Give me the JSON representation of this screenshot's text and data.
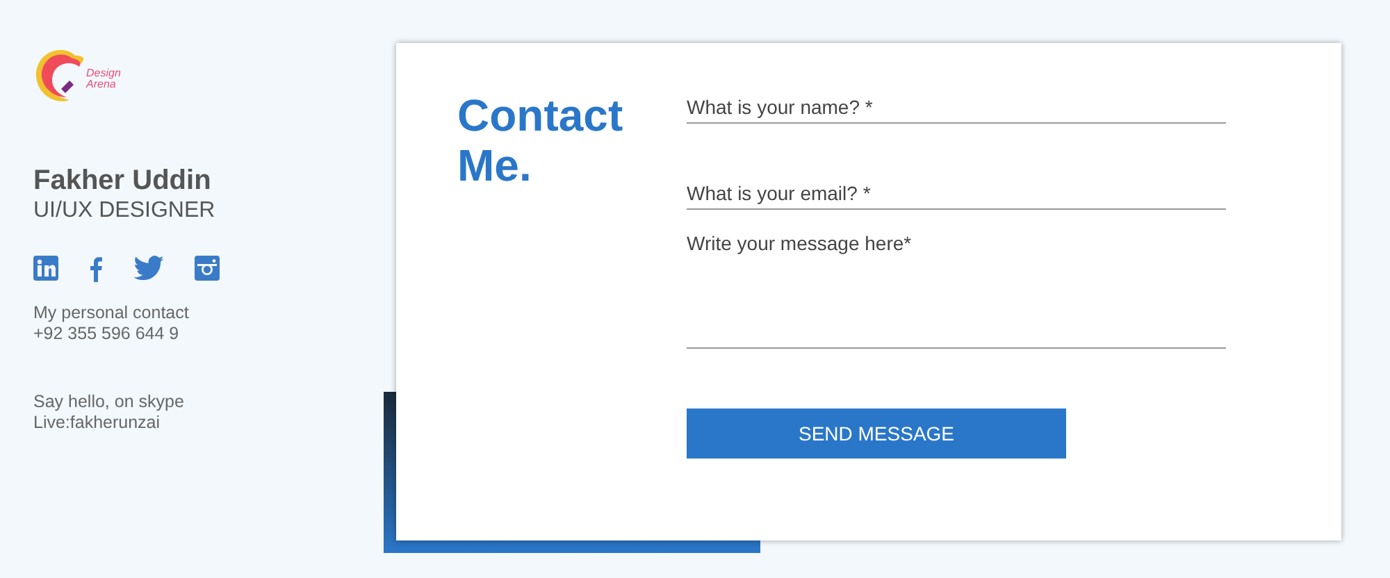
{
  "logo": {
    "line_1": "Design",
    "line_2": "Arena"
  },
  "profile": {
    "name": "Fakher Uddin",
    "role": "UI/UX DESIGNER"
  },
  "social": [
    {
      "kind": "linkedin"
    },
    {
      "kind": "facebook"
    },
    {
      "kind": "twitter"
    },
    {
      "kind": "instagram"
    }
  ],
  "contacts": [
    {
      "label": "My personal contact",
      "value": "+92 355 596 644 9"
    },
    {
      "label": "Say hello, on skype",
      "value": "Live:fakherunzai"
    }
  ],
  "form": {
    "title_1": "Contact",
    "title_2": "Me.",
    "fields": [
      {
        "kind": "line",
        "placeholder": "What is your name? *"
      },
      {
        "kind": "line",
        "placeholder": "What is your email? *"
      },
      {
        "kind": "area",
        "placeholder": "Write your message here*"
      }
    ],
    "submit": "SEND MESSAGE"
  }
}
